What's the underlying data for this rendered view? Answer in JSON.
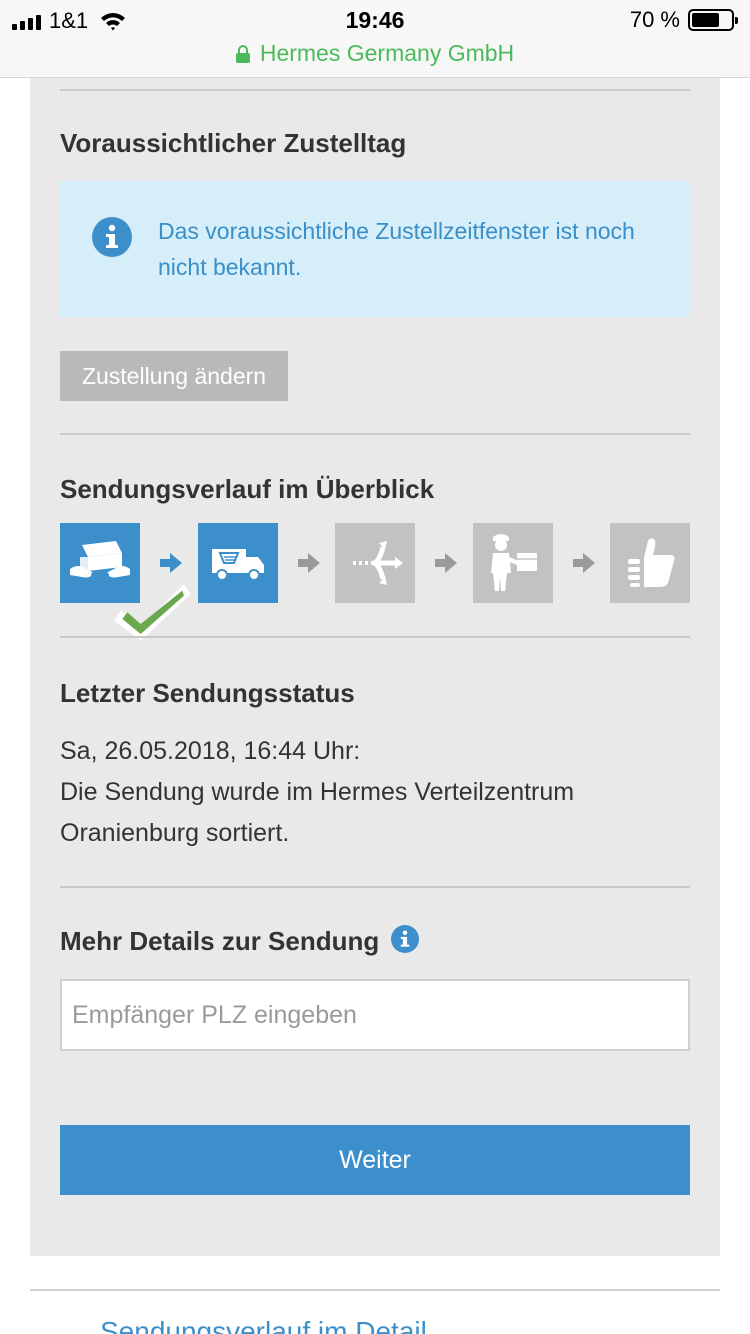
{
  "status_bar": {
    "carrier": "1&1",
    "time": "19:46",
    "battery": "70 %",
    "battery_level": 0.7,
    "site": "Hermes Germany GmbH"
  },
  "delivery_day": {
    "title": "Voraussichtlicher Zustelltag",
    "info": "Das voraussichtliche Zustellzeitfenster ist noch nicht bekannt.",
    "change_button": "Zustellung ändern"
  },
  "overview": {
    "title": "Sendungsverlauf im Überblick",
    "steps": [
      {
        "icon": "parcel-handover-icon",
        "state": "active",
        "completed": true
      },
      {
        "icon": "delivery-truck-icon",
        "state": "active",
        "completed": false
      },
      {
        "icon": "sorting-center-icon",
        "state": "inactive",
        "completed": false
      },
      {
        "icon": "courier-icon",
        "state": "inactive",
        "completed": false
      },
      {
        "icon": "thumbs-up-icon",
        "state": "inactive",
        "completed": false
      }
    ]
  },
  "last_status": {
    "title": "Letzter Sendungsstatus",
    "timestamp": "Sa, 26.05.2018, 16:44 Uhr:",
    "message": "Die Sendung wurde im Hermes Verteilzentrum Oranienburg sortiert."
  },
  "details": {
    "title": "Mehr Details zur Sendung",
    "plz_placeholder": "Empfänger PLZ eingeben",
    "plz_value": "",
    "submit_button": "Weiter"
  },
  "footer_link": "Sendungsverlauf im Detail",
  "colors": {
    "accent": "#3d8fcc",
    "panel": "#e9e9e9",
    "info_bg": "#d5eefa",
    "inactive": "#c2c2c2",
    "check": "#6aa84f",
    "secure": "#4cba5c"
  }
}
